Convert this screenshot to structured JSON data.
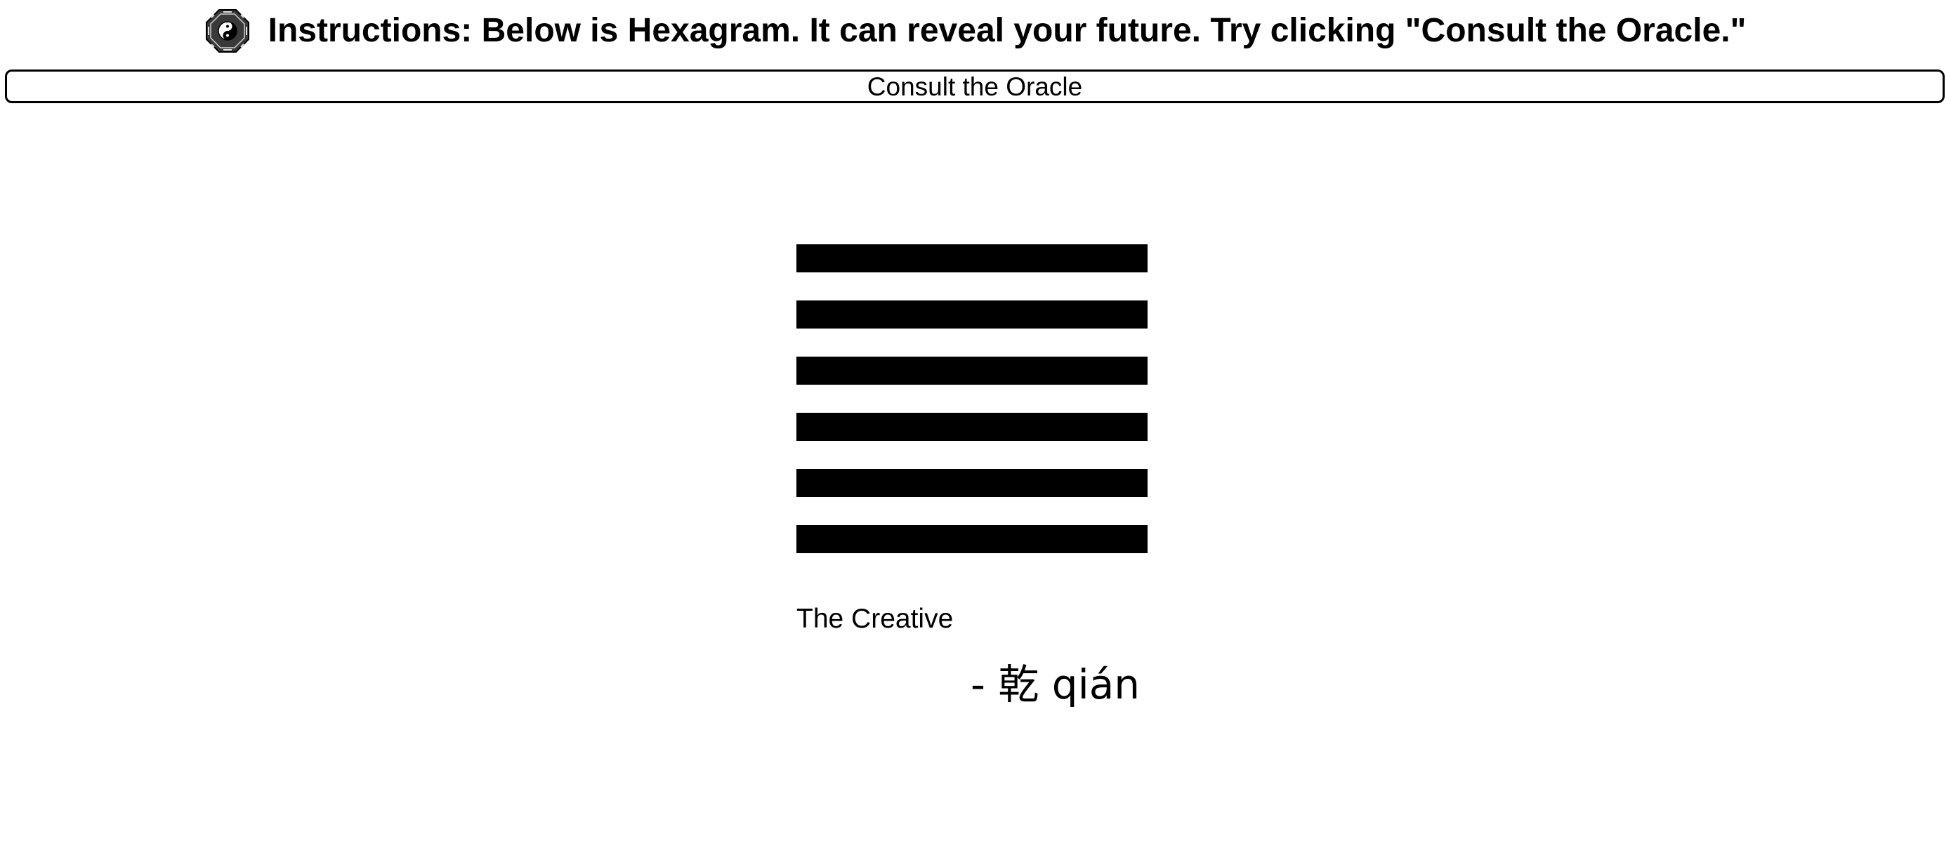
{
  "header": {
    "icon": "yin-yang-bagua-icon",
    "title": "Instructions: Below is Hexagram. It can reveal your future. Try clicking \"Consult the Oracle.\""
  },
  "oracle_button": {
    "label": "Consult the Oracle"
  },
  "hexagram": {
    "lines": [
      "solid",
      "solid",
      "solid",
      "solid",
      "solid",
      "solid"
    ],
    "name": "The Creative",
    "chinese": "- 乾 qián"
  },
  "colors": {
    "text": "#000000",
    "background": "#ffffff",
    "line": "#000000"
  }
}
